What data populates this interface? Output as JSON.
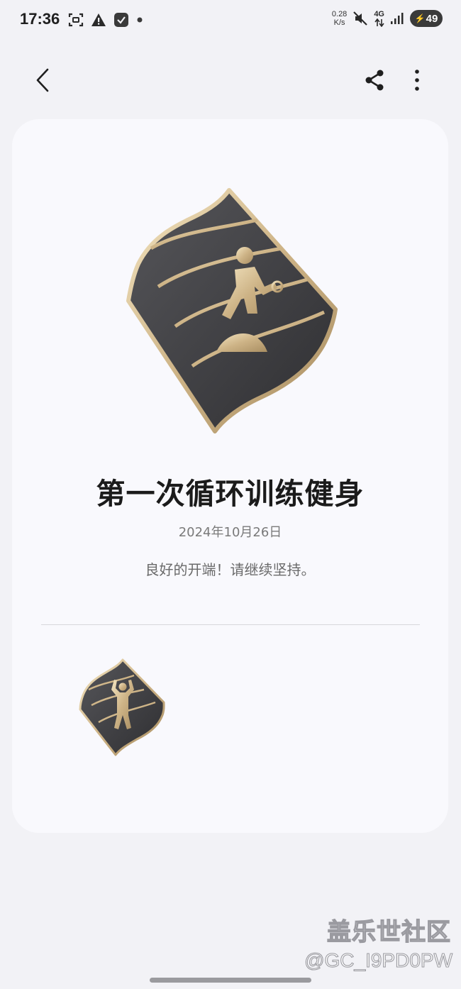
{
  "status_bar": {
    "time": "17:36",
    "net_speed_value": "0.28",
    "net_speed_unit": "K/s",
    "network_type": "4G",
    "battery_level": "49",
    "icons": [
      "screenshot-icon",
      "warning-icon",
      "app-check-icon",
      "notification-dot-icon",
      "mute-icon",
      "data-arrows-icon",
      "signal-icon",
      "charging-bolt-icon"
    ]
  },
  "app_bar": {
    "icons": [
      "back-chevron-icon",
      "share-icon",
      "more-vert-icon"
    ]
  },
  "badge": {
    "title": "第一次循环训练健身",
    "date": "2024年10月26日",
    "description": "良好的开端！请继续坚持。"
  },
  "colors": {
    "background": "#f2f2f6",
    "card": "#f9f9fd",
    "badge_dark": "#3a3a3c",
    "badge_gold": "#d9c39a",
    "title_text": "#1b1b1b",
    "secondary_text": "#7a7a7a"
  },
  "watermark": {
    "title": "盖乐世社区",
    "id": "@GC_I9PD0PW"
  }
}
